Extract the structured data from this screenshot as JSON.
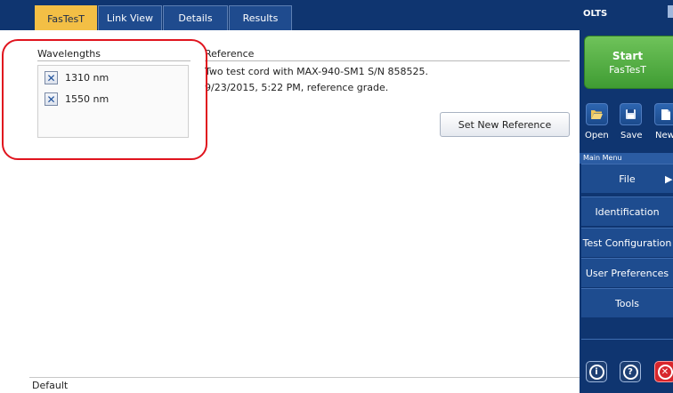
{
  "tabs": [
    {
      "label": "FasTesT",
      "active": true
    },
    {
      "label": "Link View",
      "active": false
    },
    {
      "label": "Details",
      "active": false
    },
    {
      "label": "Results",
      "active": false
    }
  ],
  "wavelengths": {
    "title": "Wavelengths",
    "items": [
      {
        "label": "1310 nm",
        "checked": true
      },
      {
        "label": "1550 nm",
        "checked": true
      }
    ]
  },
  "reference": {
    "title": "Reference",
    "line1": "Two test cord with MAX-940-SM1 S/N 858525.",
    "line2": "9/23/2015, 5:22 PM, reference grade.",
    "set_button": "Set New Reference"
  },
  "status": {
    "text": "Default"
  },
  "side": {
    "app_title": "OLTS",
    "start": {
      "main": "Start",
      "sub": "FasTesT",
      "color": "#4caf3f"
    },
    "file_buttons": [
      {
        "label": "Open",
        "icon": "folder-open-icon"
      },
      {
        "label": "Save",
        "icon": "floppy-disk-icon"
      },
      {
        "label": "New",
        "icon": "new-document-icon"
      }
    ],
    "menu_header": "Main Menu",
    "menu": [
      {
        "label": "File",
        "has_submenu": true
      },
      {
        "label": "Identification"
      },
      {
        "label": "Test Configuration"
      },
      {
        "label": "User Preferences"
      },
      {
        "label": "Tools"
      }
    ],
    "bottom_buttons": [
      {
        "icon": "info-icon"
      },
      {
        "icon": "help-icon"
      },
      {
        "icon": "close-icon"
      }
    ]
  },
  "colors": {
    "accent_tab": "#f3bf45",
    "sidebar": "#0f3570",
    "highlight": "#e0141e"
  }
}
